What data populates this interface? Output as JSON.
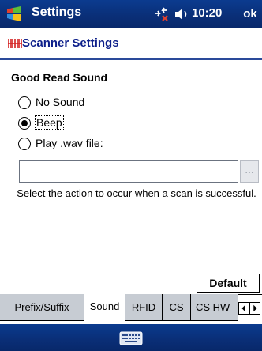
{
  "titlebar": {
    "title": "Settings",
    "time": "10:20",
    "ok_label": "ok",
    "icons": [
      "windows-start-icon",
      "connectivity-icon",
      "volume-icon"
    ]
  },
  "header": {
    "title": "Scanner Settings",
    "icon": "scanner-app-icon"
  },
  "section": {
    "title": "Good Read Sound"
  },
  "options": [
    {
      "label": "No Sound",
      "selected": false
    },
    {
      "label": "Beep",
      "selected": true
    },
    {
      "label": "Play .wav file:",
      "selected": false
    }
  ],
  "wav": {
    "value": "",
    "browse_label": "..."
  },
  "hint": "Select the action to occur when a scan is successful.",
  "default_label": "Default",
  "tabs": [
    {
      "label": "Prefix/Suffix",
      "active": false
    },
    {
      "label": "Sound",
      "active": true
    },
    {
      "label": "RFID",
      "active": false
    },
    {
      "label": "CS",
      "active": false
    },
    {
      "label": "CS HW",
      "active": false
    }
  ],
  "bottombar": {
    "icon": "keyboard-icon"
  },
  "colors": {
    "titlebar": "#0a2f78",
    "header_text": "#0d1f8a",
    "inactive_tab": "#c7ccd3"
  }
}
